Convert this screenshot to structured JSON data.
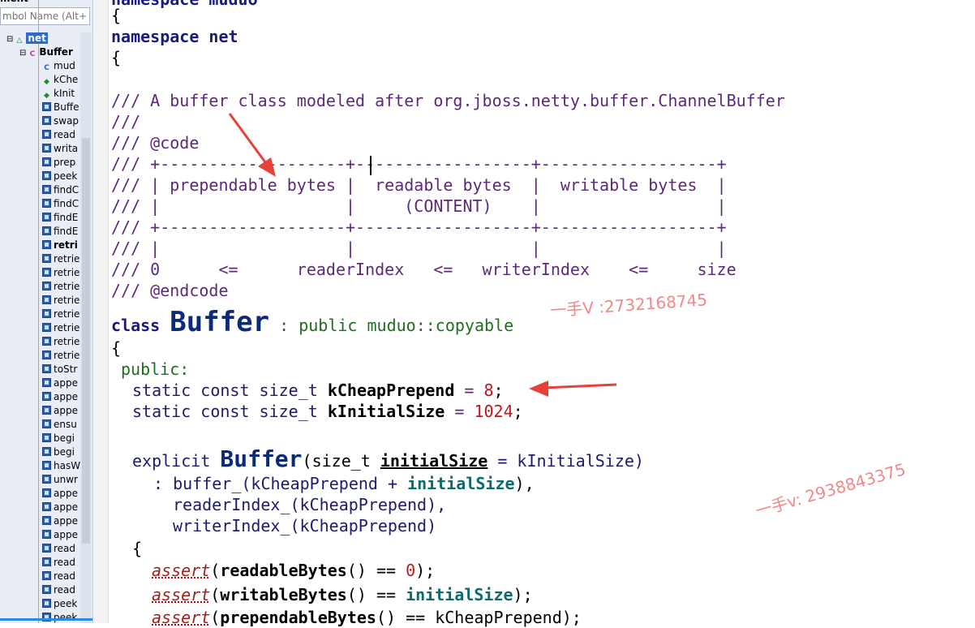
{
  "panel": {
    "title": "ment",
    "search_placeholder": "mbol Name (Alt+L)",
    "items": [
      {
        "label": "net",
        "kind": "ns",
        "level": 0,
        "selected": true
      },
      {
        "label": "Buffer",
        "kind": "class",
        "level": 1
      },
      {
        "label": "mud",
        "kind": "ctor",
        "level": 2
      },
      {
        "label": "kChe",
        "kind": "const",
        "level": 2
      },
      {
        "label": "kInit",
        "kind": "const",
        "level": 2
      },
      {
        "label": "Buffe",
        "kind": "method",
        "level": 2
      },
      {
        "label": "swap",
        "kind": "method",
        "level": 2
      },
      {
        "label": "read",
        "kind": "method",
        "level": 2
      },
      {
        "label": "writa",
        "kind": "method",
        "level": 2
      },
      {
        "label": "prep",
        "kind": "method",
        "level": 2
      },
      {
        "label": "peek",
        "kind": "method",
        "level": 2
      },
      {
        "label": "findC",
        "kind": "method",
        "level": 2
      },
      {
        "label": "findC",
        "kind": "method",
        "level": 2
      },
      {
        "label": "findE",
        "kind": "method",
        "level": 2
      },
      {
        "label": "findE",
        "kind": "method",
        "level": 2
      },
      {
        "label": "retri",
        "kind": "method",
        "level": 2,
        "bold": true
      },
      {
        "label": "retrie",
        "kind": "method",
        "level": 2
      },
      {
        "label": "retrie",
        "kind": "method",
        "level": 2
      },
      {
        "label": "retrie",
        "kind": "method",
        "level": 2
      },
      {
        "label": "retrie",
        "kind": "method",
        "level": 2
      },
      {
        "label": "retrie",
        "kind": "method",
        "level": 2
      },
      {
        "label": "retrie",
        "kind": "method",
        "level": 2
      },
      {
        "label": "retrie",
        "kind": "method",
        "level": 2
      },
      {
        "label": "retrie",
        "kind": "method",
        "level": 2
      },
      {
        "label": "toStr",
        "kind": "method",
        "level": 2
      },
      {
        "label": "appe",
        "kind": "method",
        "level": 2
      },
      {
        "label": "appe",
        "kind": "method",
        "level": 2
      },
      {
        "label": "appe",
        "kind": "method",
        "level": 2
      },
      {
        "label": "ensu",
        "kind": "method",
        "level": 2
      },
      {
        "label": "begi",
        "kind": "method",
        "level": 2
      },
      {
        "label": "begi",
        "kind": "method",
        "level": 2
      },
      {
        "label": "hasW",
        "kind": "method",
        "level": 2
      },
      {
        "label": "unwr",
        "kind": "method",
        "level": 2
      },
      {
        "label": "appe",
        "kind": "method",
        "level": 2
      },
      {
        "label": "appe",
        "kind": "method",
        "level": 2
      },
      {
        "label": "appe",
        "kind": "method",
        "level": 2
      },
      {
        "label": "appe",
        "kind": "method",
        "level": 2
      },
      {
        "label": "read",
        "kind": "method",
        "level": 2
      },
      {
        "label": "read",
        "kind": "method",
        "level": 2
      },
      {
        "label": "read",
        "kind": "method",
        "level": 2
      },
      {
        "label": "read",
        "kind": "method",
        "level": 2
      },
      {
        "label": "peek",
        "kind": "method",
        "level": 2
      },
      {
        "label": "peek",
        "kind": "method",
        "level": 2
      }
    ]
  },
  "code": {
    "l0": "namespace muduo",
    "l1": "{",
    "l2_kw": "namespace",
    "l2_name": "net",
    "l3": "{",
    "l4": "/// A buffer class modeled after org.jboss.netty.buffer.ChannelBuffer",
    "l5": "///",
    "l6": "/// @code",
    "l7": "/// +-------------------+------------------+------------------+",
    "l8": "/// | prependable bytes |  readable bytes  |  writable bytes  |",
    "l9": "/// |                   |     (CONTENT)    |                  |",
    "l10": "/// +-------------------+------------------+------------------+",
    "l11": "/// |                   |                  |                  |",
    "l12": "/// 0      <=      readerIndex   <=   writerIndex    <=     size",
    "l13": "/// @endcode",
    "l14_kw": "class",
    "l14_name": "Buffer",
    "l14_rest": " : public muduo::copyable",
    "l15": "{",
    "l16": "public:",
    "l17_a": "static const size_t ",
    "l17_b": "kCheapPrepend",
    "l17_c": " = ",
    "l17_d": "8",
    "l17_e": ";",
    "l18_a": "static const size_t ",
    "l18_b": "kInitialSize",
    "l18_c": " = ",
    "l18_d": "1024",
    "l18_e": ";",
    "l19_kw": "explicit ",
    "l19_name": "Buffer",
    "l19_a": "(size_t ",
    "l19_b": "initialSize",
    "l19_c": " = kInitialSize)",
    "l20_a": ": buffer_(kCheapPrepend + ",
    "l20_b": "initialSize",
    "l20_c": "),",
    "l21": "readerIndex_(kCheapPrepend),",
    "l22": "writerIndex_(kCheapPrepend)",
    "l23": "{",
    "l24_a": "assert",
    "l24_b": "(",
    "l24_c": "readableBytes",
    "l24_d": "() == ",
    "l24_e": "0",
    "l24_f": ");",
    "l25_a": "assert",
    "l25_b": "(",
    "l25_c": "writableBytes",
    "l25_d": "() == ",
    "l25_e": "initialSize",
    "l25_f": ");",
    "l26_a": "assert",
    "l26_b": "(",
    "l26_c": "prependableBytes",
    "l26_d": "() == kCheapPrepend);"
  },
  "watermarks": {
    "w1": "一手V :2732168745",
    "w2": "一手v: 2938843375"
  },
  "colors": {
    "accent_arrow": "#e8413a",
    "watermark": "#f08a8a",
    "keyword": "#1a1a80",
    "number": "#c0171c"
  }
}
